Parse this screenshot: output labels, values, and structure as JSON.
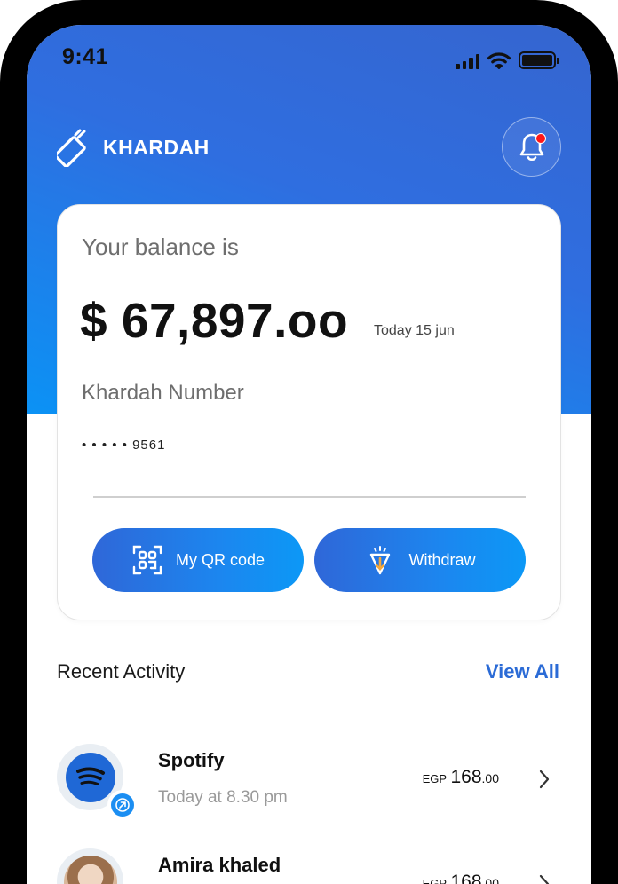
{
  "status_bar": {
    "time": "9:41"
  },
  "header": {
    "brand_name": "KHARDAH",
    "notification_unread": true
  },
  "balance_card": {
    "balance_label": "Your balance is",
    "balance_amount": "$ 67,897.oo",
    "balance_date": "Today 15 jun",
    "number_label": "Khardah Number",
    "number_masked": "• • • • •  9561",
    "qr_button_label": "My QR code",
    "withdraw_button_label": "Withdraw"
  },
  "recent_activity": {
    "title": "Recent Activity",
    "view_all_label": "View All",
    "items": [
      {
        "name": "Spotify",
        "time": "Today at 8.30 pm",
        "currency": "EGP",
        "amount_int": "168",
        "amount_dec": ".00"
      },
      {
        "name": "Amira khaled",
        "time": "",
        "currency": "EGP",
        "amount_int": "168",
        "amount_dec": ".00"
      }
    ]
  },
  "colors": {
    "brand_blue": "#2f6ee0",
    "accent_blue": "#0b92f5",
    "link_blue": "#2b6bd6",
    "notification_red": "#ff1717"
  }
}
